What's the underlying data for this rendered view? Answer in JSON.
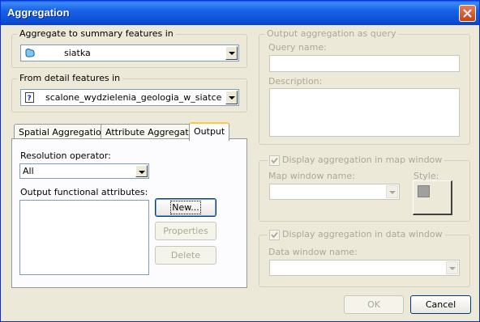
{
  "window": {
    "title": "Aggregation"
  },
  "summary_group": {
    "legend": "Aggregate to summary features in",
    "value": "siatka",
    "icon": "polygon-layer-icon"
  },
  "detail_group": {
    "legend": "From detail features in",
    "value": "scalone_wydzielenia_geologia_w_siatce",
    "icon": "unknown-layer-icon"
  },
  "tabs": [
    {
      "label": "Spatial Aggregation"
    },
    {
      "label": "Attribute Aggregation"
    },
    {
      "label": "Output"
    }
  ],
  "output_tab": {
    "resolution_label": "Resolution operator:",
    "resolution_value": "All",
    "attributes_label": "Output functional attributes:",
    "new_button": "New...",
    "properties_button": "Properties",
    "delete_button": "Delete"
  },
  "query_group": {
    "legend": "Output aggregation as query",
    "query_name_label": "Query name:",
    "query_name_value": "",
    "description_label": "Description:",
    "description_value": ""
  },
  "map_group": {
    "checkbox_label": "Display aggregation in map window",
    "checked": true,
    "map_window_label": "Map window name:",
    "map_window_value": "",
    "style_label": "Style:"
  },
  "data_group": {
    "checkbox_label": "Display aggregation in data window",
    "checked": true,
    "data_window_label": "Data window name:",
    "data_window_value": ""
  },
  "footer": {
    "ok_button": "OK",
    "cancel_button": "Cancel"
  },
  "colors": {
    "titlebar": "#0a4fd6",
    "face": "#ece9d8",
    "disabled_text": "#aca899"
  }
}
